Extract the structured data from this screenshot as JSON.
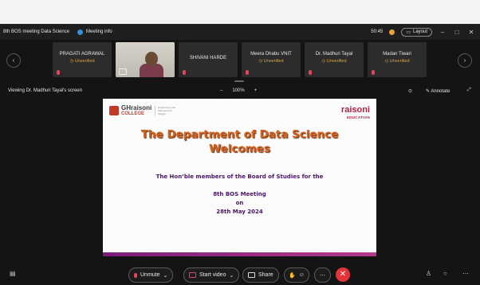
{
  "titlebar": {
    "title": "8th BOS meeting Data Science",
    "meeting_info": "Meeting info",
    "time": "50:45",
    "layout": "Layout",
    "minimize": "–",
    "maximize": "□",
    "close": "✕"
  },
  "participants": [
    {
      "name": "PRAGATI AGRAWAL",
      "status": "Unverified"
    },
    {
      "name": "SHIVANI HARDE",
      "status": ""
    },
    {
      "name": "Meera Dhabu VNIT",
      "status": "Unverified"
    },
    {
      "name": "Dr. Madhuri Tayal",
      "status": "Unverified"
    },
    {
      "name": "Madan Tiwari",
      "status": "Unverified"
    }
  ],
  "sharebar": {
    "viewing": "Viewing Dr. Madhuri Tayal's screen",
    "zoom_out": "–",
    "zoom": "100%",
    "zoom_in": "+",
    "annotate": "Annotate"
  },
  "slide": {
    "logo_gh": "GHraisoni",
    "logo_college": "COLLEGE",
    "logo_sub": "Engineering and Management Nagpur",
    "brand": "raisoni",
    "brand_sub": "EDUCATION",
    "heading1": "The Department of Data Science",
    "heading2": "Welcomes",
    "line1": "The Hon’ble members of the Board of  Studies for the",
    "line2": "8th BOS Meeting",
    "line3": "on",
    "line4": "28th May 2024"
  },
  "controls": {
    "unmute": "Unmute",
    "start_video": "Start video",
    "share": "Share"
  }
}
